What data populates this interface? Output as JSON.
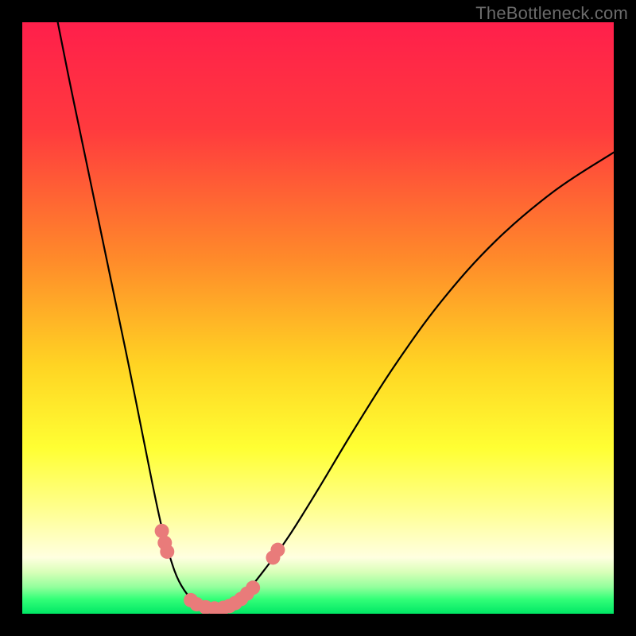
{
  "watermark": "TheBottleneck.com",
  "chart_data": {
    "type": "line",
    "title": "",
    "xlabel": "",
    "ylabel": "",
    "xlim": [
      0,
      100
    ],
    "ylim": [
      0,
      100
    ],
    "gradient_stops": [
      {
        "offset": 0.0,
        "color": "#ff1f4b"
      },
      {
        "offset": 0.18,
        "color": "#ff3a3e"
      },
      {
        "offset": 0.4,
        "color": "#ff8a2a"
      },
      {
        "offset": 0.58,
        "color": "#ffd423"
      },
      {
        "offset": 0.72,
        "color": "#ffff33"
      },
      {
        "offset": 0.82,
        "color": "#ffff8c"
      },
      {
        "offset": 0.88,
        "color": "#ffffc8"
      },
      {
        "offset": 0.905,
        "color": "#ffffe0"
      },
      {
        "offset": 0.93,
        "color": "#d8ffb8"
      },
      {
        "offset": 0.955,
        "color": "#92ff9c"
      },
      {
        "offset": 0.975,
        "color": "#34ff78"
      },
      {
        "offset": 1.0,
        "color": "#00e765"
      }
    ],
    "series": [
      {
        "name": "bottleneck-curve",
        "type": "line",
        "points": [
          {
            "x": 6.0,
            "y": 100.0
          },
          {
            "x": 8.0,
            "y": 90.0
          },
          {
            "x": 10.5,
            "y": 78.0
          },
          {
            "x": 13.0,
            "y": 66.0
          },
          {
            "x": 15.5,
            "y": 54.0
          },
          {
            "x": 18.0,
            "y": 42.0
          },
          {
            "x": 20.0,
            "y": 32.0
          },
          {
            "x": 22.0,
            "y": 22.0
          },
          {
            "x": 23.5,
            "y": 15.0
          },
          {
            "x": 25.0,
            "y": 9.5
          },
          {
            "x": 26.5,
            "y": 5.5
          },
          {
            "x": 28.5,
            "y": 2.5
          },
          {
            "x": 30.0,
            "y": 1.2
          },
          {
            "x": 32.0,
            "y": 0.8
          },
          {
            "x": 34.0,
            "y": 1.0
          },
          {
            "x": 36.0,
            "y": 2.0
          },
          {
            "x": 38.0,
            "y": 3.8
          },
          {
            "x": 41.0,
            "y": 7.5
          },
          {
            "x": 45.0,
            "y": 13.0
          },
          {
            "x": 50.0,
            "y": 21.0
          },
          {
            "x": 56.0,
            "y": 31.0
          },
          {
            "x": 63.0,
            "y": 42.0
          },
          {
            "x": 71.0,
            "y": 53.0
          },
          {
            "x": 80.0,
            "y": 63.0
          },
          {
            "x": 90.0,
            "y": 71.5
          },
          {
            "x": 100.0,
            "y": 78.0
          }
        ]
      },
      {
        "name": "markers-left",
        "type": "scatter",
        "color": "#e97b7a",
        "points": [
          {
            "x": 23.6,
            "y": 14.0
          },
          {
            "x": 24.1,
            "y": 12.0
          },
          {
            "x": 24.5,
            "y": 10.5
          }
        ]
      },
      {
        "name": "markers-bottom",
        "type": "scatter",
        "color": "#e97b7a",
        "points": [
          {
            "x": 28.5,
            "y": 2.3
          },
          {
            "x": 29.5,
            "y": 1.6
          },
          {
            "x": 31.0,
            "y": 1.1
          },
          {
            "x": 32.5,
            "y": 0.9
          },
          {
            "x": 34.0,
            "y": 1.0
          },
          {
            "x": 35.0,
            "y": 1.3
          },
          {
            "x": 36.0,
            "y": 1.8
          },
          {
            "x": 37.0,
            "y": 2.5
          },
          {
            "x": 38.0,
            "y": 3.4
          },
          {
            "x": 39.0,
            "y": 4.4
          }
        ]
      },
      {
        "name": "markers-right",
        "type": "scatter",
        "color": "#e97b7a",
        "points": [
          {
            "x": 42.4,
            "y": 9.5
          },
          {
            "x": 43.2,
            "y": 10.8
          }
        ]
      }
    ]
  }
}
